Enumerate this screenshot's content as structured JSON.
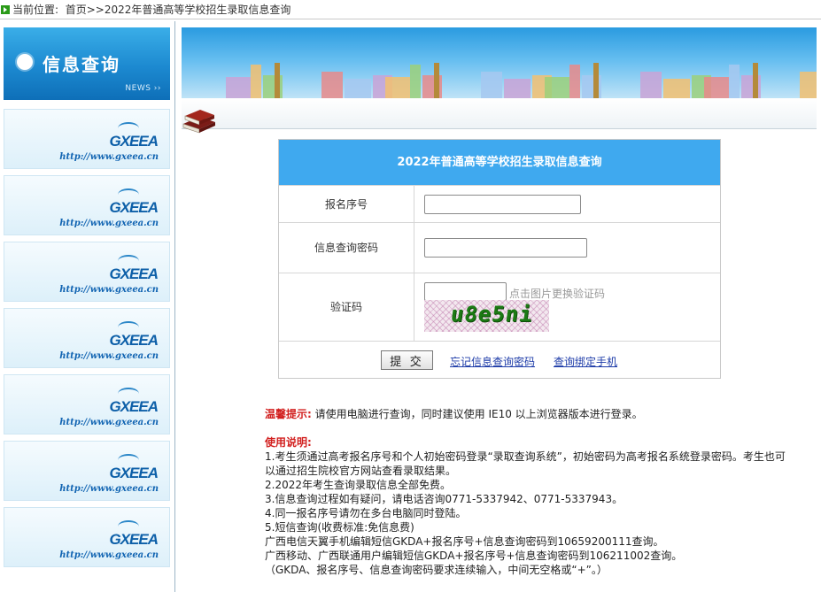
{
  "breadcrumb": {
    "prefix": "当前位置:",
    "home": "首页",
    "separator": ">>",
    "current": "2022年普通高等学校招生录取信息查询"
  },
  "sidebar": {
    "title": "信息查询",
    "news_label": "NEWS ››",
    "banners": [
      {
        "logo": "GXEEA",
        "url": "http://www.gxeea.cn"
      },
      {
        "logo": "GXEEA",
        "url": "http://www.gxeea.cn"
      },
      {
        "logo": "GXEEA",
        "url": "http://www.gxeea.cn"
      },
      {
        "logo": "GXEEA",
        "url": "http://www.gxeea.cn"
      },
      {
        "logo": "GXEEA",
        "url": "http://www.gxeea.cn"
      },
      {
        "logo": "GXEEA",
        "url": "http://www.gxeea.cn"
      },
      {
        "logo": "GXEEA",
        "url": "http://www.gxeea.cn"
      }
    ]
  },
  "form": {
    "title": "2022年普通高等学校招生录取信息查询",
    "fields": {
      "registration_label": "报名序号",
      "registration_value": "",
      "password_label": "信息查询密码",
      "password_value": "",
      "captcha_label": "验证码",
      "captcha_value": "",
      "captcha_hint": "点击图片更换验证码",
      "captcha_image_text": "u8e5ni"
    },
    "submit_label": "提 交",
    "forgot_link": "忘记信息查询密码",
    "bind_link": "查询绑定手机"
  },
  "notes": {
    "tip_label": "温馨提示:",
    "tip_text": "请使用电脑进行查询，同时建议使用 IE10 以上浏览器版本进行登录。",
    "usage_label": "使用说明:",
    "lines": [
      "1.考生须通过高考报名序号和个人初始密码登录“录取查询系统”，初始密码为高考报名系统登录密码。考生也可以通过招生院校官方网站查看录取结果。",
      "2.2022年考生查询录取信息全部免费。",
      "3.信息查询过程如有疑问，请电话咨询0771-5337942、0771-5337943。",
      "4.同一报名序号请勿在多台电脑同时登陆。",
      "5.短信查询(收费标准:免信息费)",
      "广西电信天翼手机编辑短信GKDA+报名序号+信息查询密码到10659200111查询。",
      "广西移动、广西联通用户编辑短信GKDA+报名序号+信息查询密码到106211002查询。",
      "（GKDA、报名序号、信息查询密码要求连续输入，中间无空格或“+”。）"
    ]
  },
  "colors": {
    "form_header": "#3fa9ef",
    "sidebar_header": "#1c89d0",
    "note_red": "#d2201f",
    "link_blue": "#1d3ba8"
  }
}
